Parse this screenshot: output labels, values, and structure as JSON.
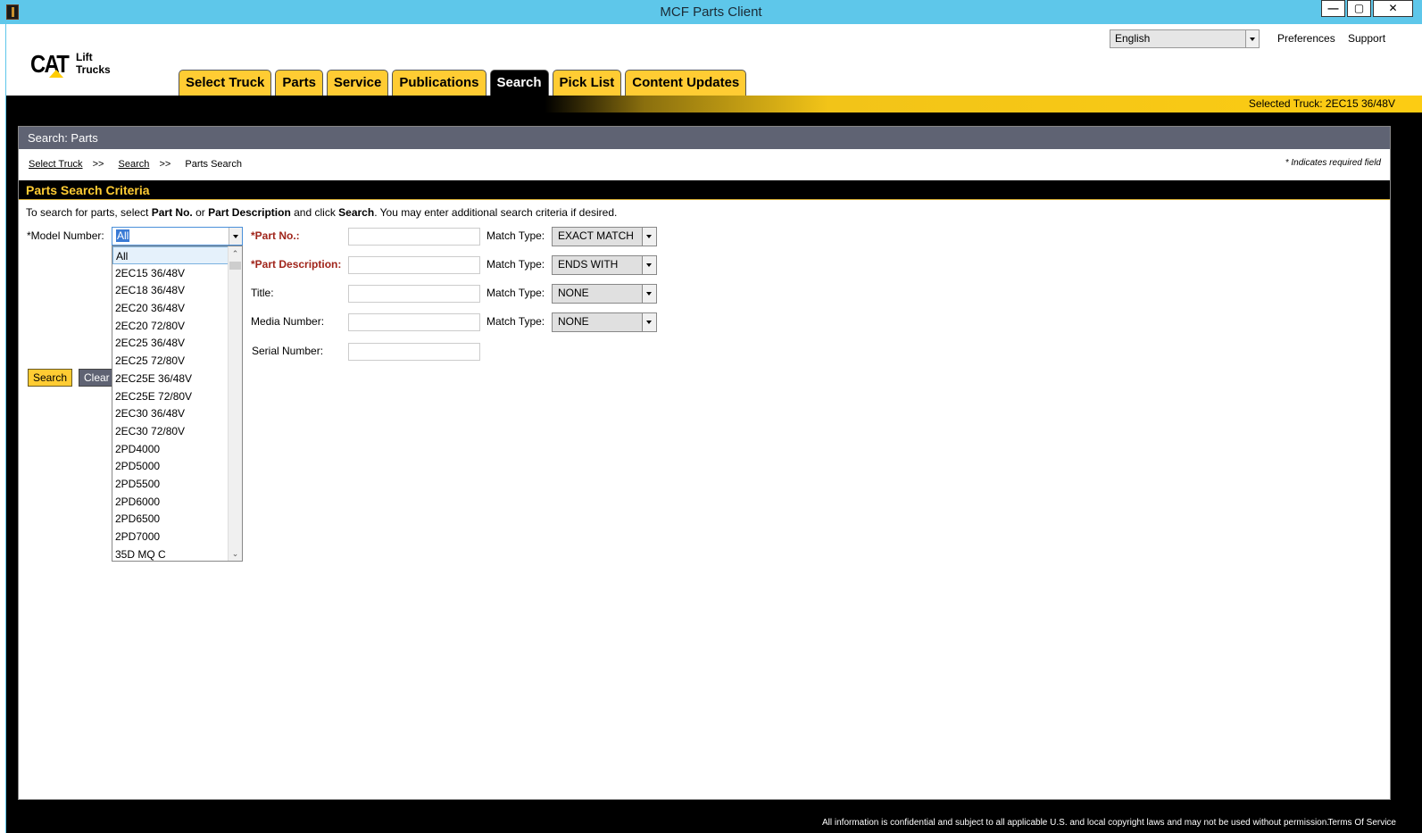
{
  "window": {
    "title": "MCF Parts Client",
    "minimize": "—",
    "maximize": "▢",
    "close": "✕"
  },
  "brand": {
    "logo_main": "CAT",
    "logo_sub_1": "Lift",
    "logo_sub_2": "Trucks",
    "accent_color": "#ffcc33"
  },
  "header": {
    "language": "English",
    "preferences": "Preferences",
    "support": "Support"
  },
  "tabs": [
    {
      "label": "Select Truck",
      "active": false
    },
    {
      "label": "Parts",
      "active": false
    },
    {
      "label": "Service",
      "active": false
    },
    {
      "label": "Publications",
      "active": false
    },
    {
      "label": "Search",
      "active": true
    },
    {
      "label": "Pick List",
      "active": false
    },
    {
      "label": "Content Updates",
      "active": false
    }
  ],
  "selected_truck": "Selected Truck:  2EC15 36/48V",
  "section_title": "Search: Parts",
  "breadcrumb": {
    "item1": "Select Truck",
    "item2": "Search",
    "item3": "Parts Search",
    "sep": ">>"
  },
  "required_note": "* Indicates required field",
  "criteria_title": "Parts Search Criteria",
  "instructions": {
    "p1": "To search for parts, select ",
    "b1": "Part No.",
    "p2": " or ",
    "b2": "Part Description",
    "p3": " and click ",
    "b3": "Search",
    "p4": ". You may enter additional search criteria if desired."
  },
  "form": {
    "model_label": "*Model Number:",
    "model_value": "All",
    "part_no_label": "*Part No.:",
    "part_desc_label": "*Part Description:",
    "title_label": "Title:",
    "media_label": "Media Number:",
    "serial_label": "Serial Number:",
    "match_label": "Match Type:",
    "match_part_no": "EXACT MATCH",
    "match_part_desc": "ENDS WITH",
    "match_title": "NONE",
    "match_media": "NONE",
    "search_button": "Search",
    "clear_button": "Clear"
  },
  "model_options": [
    "All",
    "2EC15 36/48V",
    "2EC18 36/48V",
    "2EC20 36/48V",
    "2EC20 72/80V",
    "2EC25 36/48V",
    "2EC25 72/80V",
    "2EC25E 36/48V",
    "2EC25E 72/80V",
    "2EC30 36/48V",
    "2EC30 72/80V",
    "2PD4000",
    "2PD5000",
    "2PD5500",
    "2PD6000",
    "2PD6500",
    "2PD7000",
    "35D MQ C"
  ],
  "footer": {
    "copyright": "All information is confidential and subject to all applicable U.S. and local copyright laws and may not be used without permission.",
    "terms": "Terms Of Service"
  }
}
